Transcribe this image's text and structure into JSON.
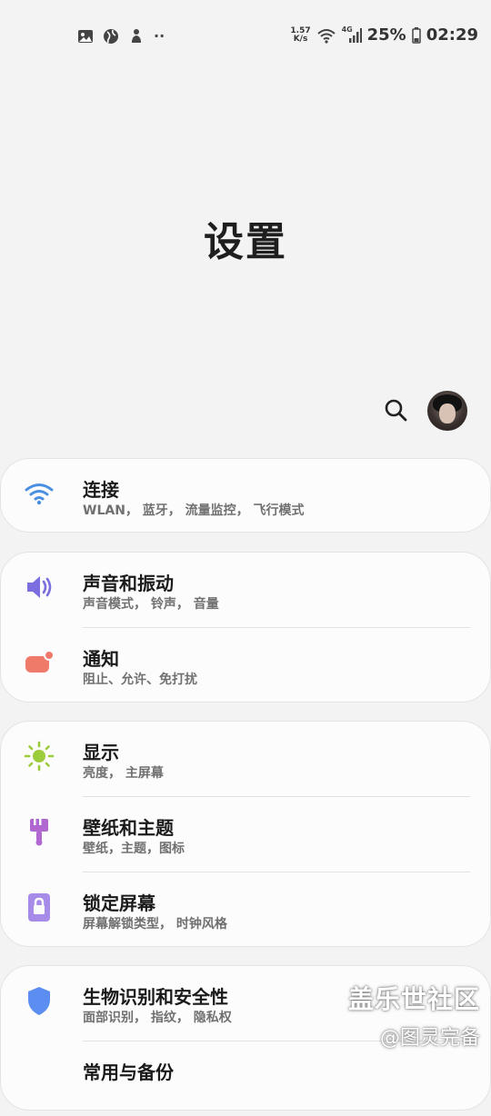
{
  "status_bar": {
    "net_speed_value": "1.57",
    "net_speed_unit": "K/s",
    "network_type": "4G",
    "battery": "25%",
    "time": "02:29",
    "overflow": "··"
  },
  "header": {
    "title": "设置"
  },
  "settings": {
    "connections": {
      "title": "连接",
      "subtitle": "WLAN， 蓝牙， 流量监控， 飞行模式"
    },
    "sounds": {
      "title": "声音和振动",
      "subtitle": "声音模式， 铃声， 音量"
    },
    "notifications": {
      "title": "通知",
      "subtitle": "阻止、允许、免打扰"
    },
    "display": {
      "title": "显示",
      "subtitle": "亮度， 主屏幕"
    },
    "wallpaper": {
      "title": "壁纸和主题",
      "subtitle": "壁纸，主题，图标"
    },
    "lockscreen": {
      "title": "锁定屏幕",
      "subtitle": "屏幕解锁类型， 时钟风格"
    },
    "biometrics": {
      "title": "生物识别和安全性",
      "subtitle": "面部识别， 指纹， 隐私权"
    },
    "partial": {
      "title": "常用与备份"
    }
  },
  "watermark": {
    "line1": "盖乐世社区",
    "line2": "@图灵完备"
  },
  "colors": {
    "wifi": "#4a90e2",
    "sound": "#7b6fe0",
    "notification": "#ef7a6a",
    "display": "#9ccc3c",
    "wallpaper": "#b068d0",
    "lockscreen": "#a78be8",
    "biometrics": "#5b8ef0"
  }
}
